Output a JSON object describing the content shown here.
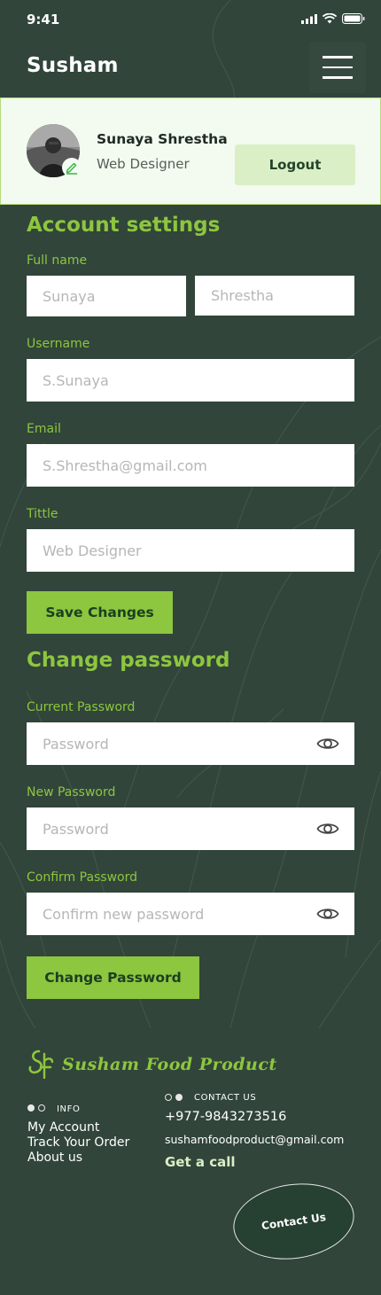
{
  "status_bar": {
    "time": "9:41"
  },
  "header": {
    "brand": "Susham",
    "menu_icon": "hamburger-menu-icon"
  },
  "profile": {
    "name": "Sunaya Shrestha",
    "role": "Web Designer",
    "logout_label": "Logout"
  },
  "account": {
    "title": "Account settings",
    "full_name_label": "Full name",
    "first_name_placeholder": "Sunaya",
    "last_name_placeholder": "Shrestha",
    "username_label": "Username",
    "username_placeholder": "S.Sunaya",
    "email_label": "Email",
    "email_placeholder": "S.Shrestha@gmail.com",
    "title_label": "Tittle",
    "title_placeholder": "Web Designer",
    "save_label": "Save Changes"
  },
  "password": {
    "title": "Change password",
    "current_label": "Current Password",
    "current_placeholder": "Password",
    "new_label": "New Password",
    "new_placeholder": "Password",
    "confirm_label": "Confirm Password",
    "confirm_placeholder": "Confirm new password",
    "submit_label": "Change Password",
    "eye_icon": "eye-icon"
  },
  "footer": {
    "logo_text": "Susham Food Product",
    "info_heading": "INFO",
    "info_links": [
      "My Account",
      "Track Your Order",
      "About us"
    ],
    "contact_heading": "CONTACT US",
    "phone": "+977-9843273516",
    "email": "sushamfoodproduct@gmail.com",
    "get_call": "Get a call",
    "contact_button": "Contact Us"
  },
  "colors": {
    "background": "#31453a",
    "accent_green": "#8dc63f",
    "light_green": "#dbefc6",
    "card_bg": "#f3faf0"
  }
}
